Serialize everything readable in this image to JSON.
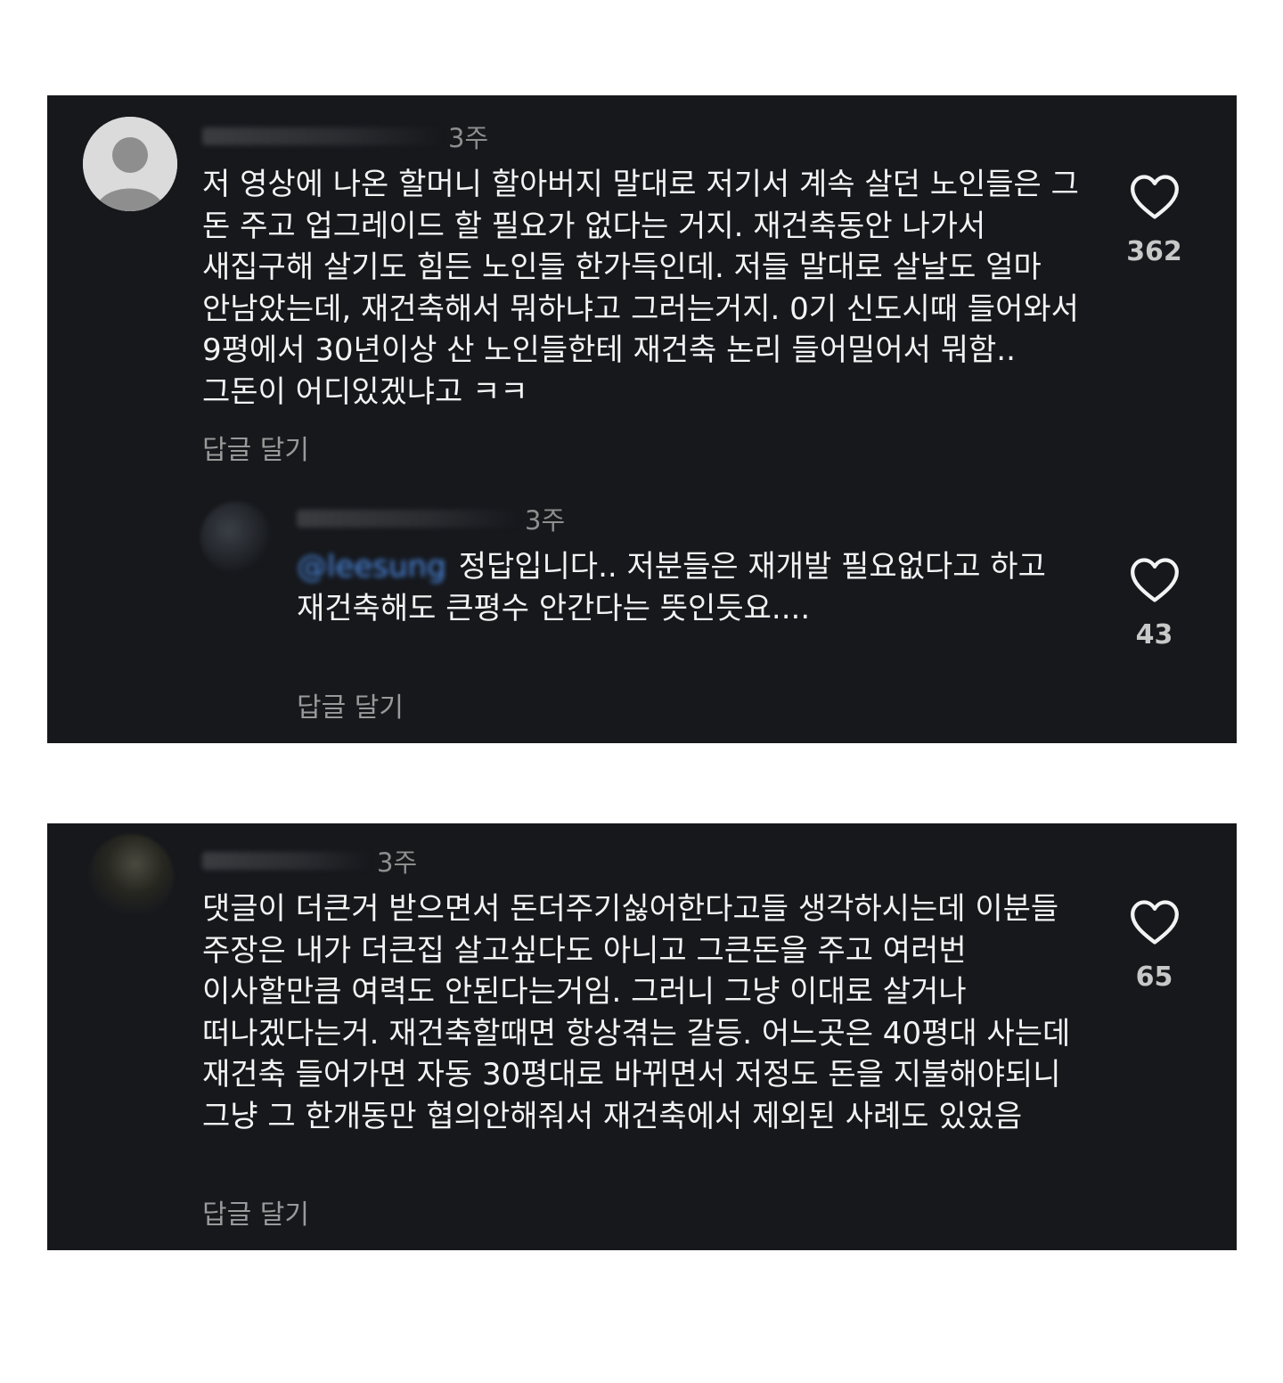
{
  "comments": [
    {
      "time": "3주",
      "text": "저 영상에 나온 할머니 할아버지 말대로 저기서 계속 살던 노인들은 그 돈 주고 업그레이드 할 필요가 없다는 거지. 재건축동안 나가서 새집구해 살기도 힘든 노인들 한가득인데. 저들 말대로 살날도 얼마 안남았는데, 재건축해서 뭐하냐고 그러는거지. 0기 신도시때 들어와서 9평에서 30년이상 산 노인들한테 재건축 논리 들어밀어서 뭐함.. 그돈이 어디있겠냐고 ㅋㅋ",
      "reply_label": "답글 달기",
      "likes": "362",
      "reply": {
        "time": "3주",
        "mention": "@leesung",
        "text": "정답입니다.. 저분들은 재개발 필요없다고 하고 재건축해도 큰평수 안간다는 뜻인듯요....",
        "reply_label": "답글 달기",
        "likes": "43"
      }
    },
    {
      "time": "3주",
      "text": "댓글이 더큰거 받으면서 돈더주기싫어한다고들 생각하시는데 이분들 주장은 내가 더큰집 살고싶다도 아니고 그큰돈을 주고 여러번 이사할만큼 여력도 안된다는거임. 그러니 그냥 이대로 살거나 떠나겠다는거.  재건축할때면 항상겪는 갈등. 어느곳은 40평대 사는데 재건축 들어가면 자동 30평대로 바뀌면서 저정도 돈을 지불해야되니 그냥 그 한개동만 협의안해줘서 재건축에서 제외된 사례도 있었음",
      "reply_label": "답글 달기",
      "likes": "65"
    }
  ],
  "colors": {
    "panel_bg": "#16181c",
    "text": "#f3f3f3",
    "muted": "#8e8e8e",
    "mention": "#4c8ce8"
  },
  "icons": [
    "default-avatar-icon",
    "heart-outline-icon"
  ]
}
